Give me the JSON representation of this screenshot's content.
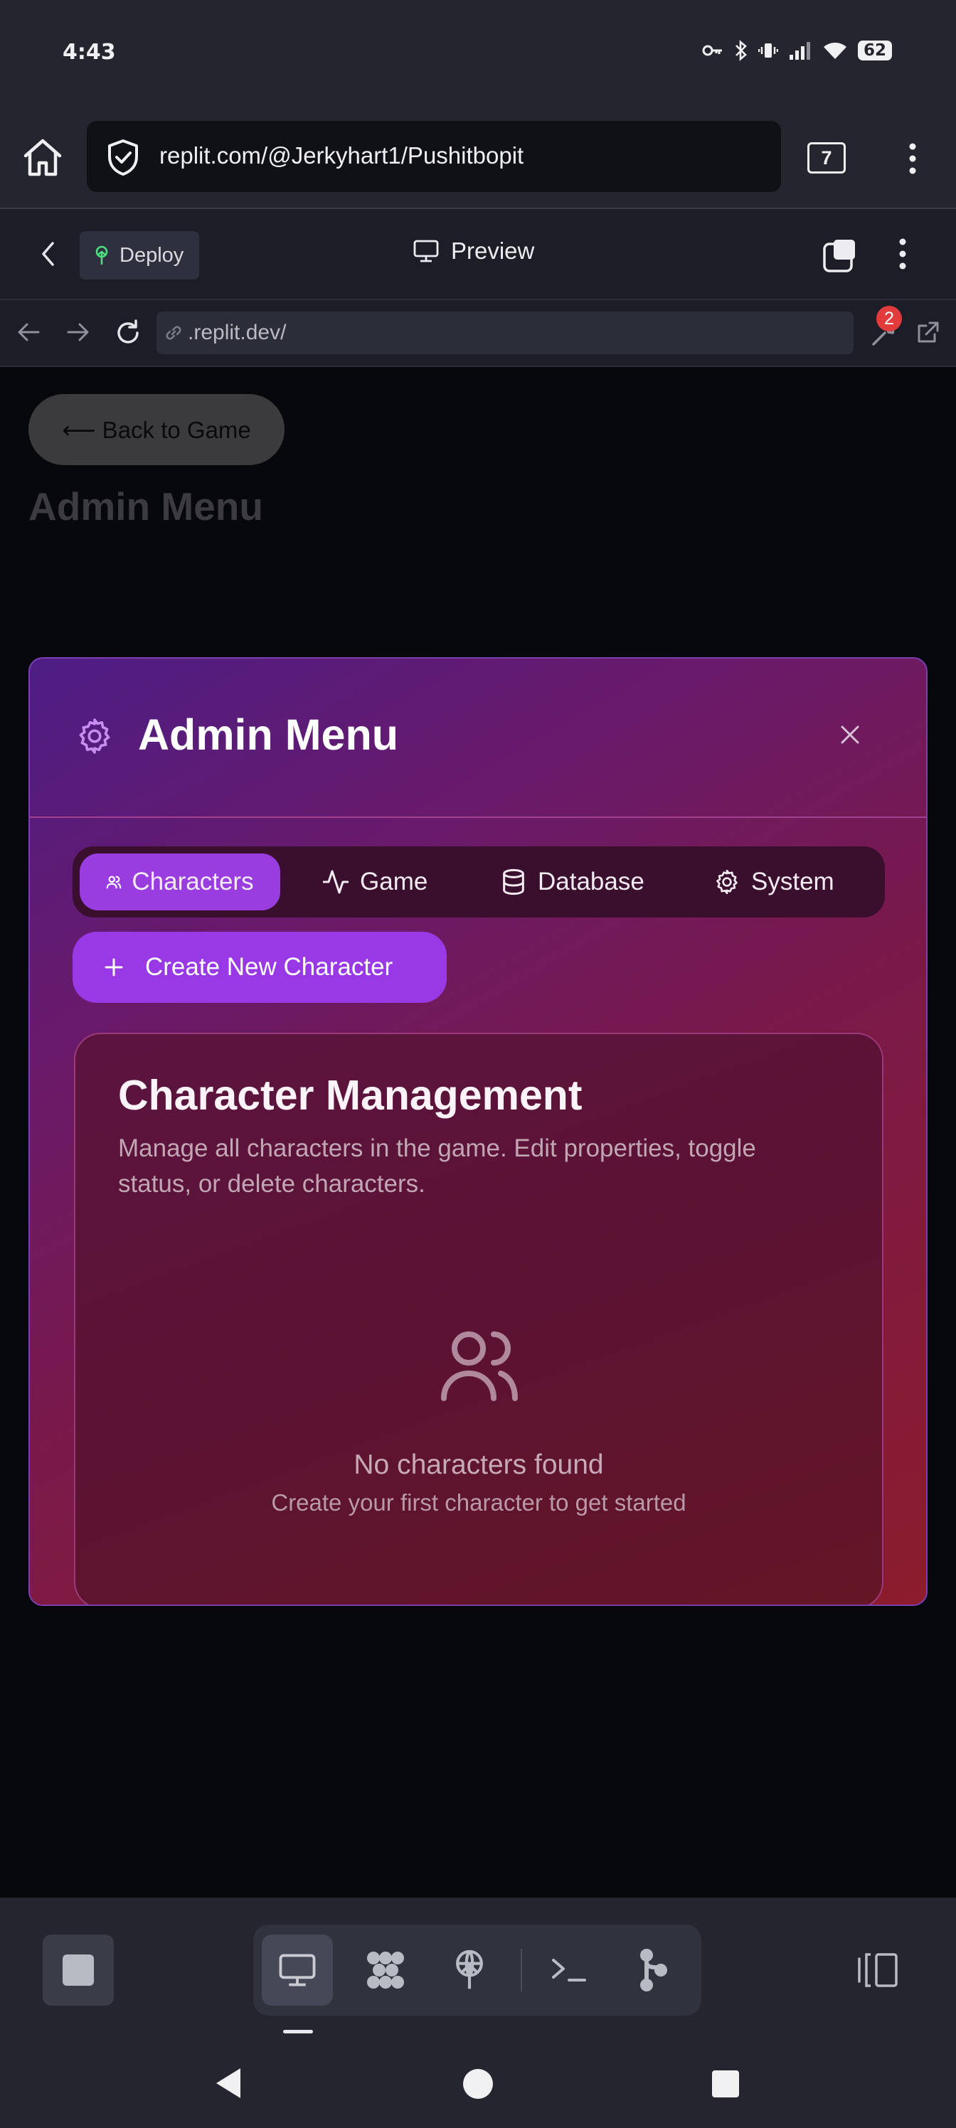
{
  "status_bar": {
    "time": "4:43",
    "battery": "62"
  },
  "browser": {
    "url": "replit.com/@Jerkyhart1/Pushitbopit",
    "tab_count": "7"
  },
  "replit_header": {
    "deploy_label": "Deploy",
    "preview_label": "Preview"
  },
  "webview": {
    "url": ".replit.dev/",
    "notification_count": "2"
  },
  "app": {
    "back_button": "⟵ Back to Game",
    "page_title": "Admin Menu"
  },
  "modal": {
    "title": "Admin Menu",
    "close_label": "×",
    "tabs": [
      {
        "label": "Characters",
        "icon": "users-icon",
        "active": true
      },
      {
        "label": "Game",
        "icon": "activity-icon",
        "active": false
      },
      {
        "label": "Database",
        "icon": "database-icon",
        "active": false
      },
      {
        "label": "System",
        "icon": "gear-icon",
        "active": false
      }
    ],
    "create_button": "Create New Character",
    "card": {
      "title": "Character Management",
      "description": "Manage all characters in the game. Edit properties, toggle status, or delete characters.",
      "empty_title": "No characters found",
      "empty_subtitle": "Create your first character to get started"
    }
  },
  "colors": {
    "modal_accent": "#9939e6",
    "modal_gradient_start": "#4d1d85",
    "modal_gradient_end": "#8c1c2d",
    "background": "#07080c"
  }
}
